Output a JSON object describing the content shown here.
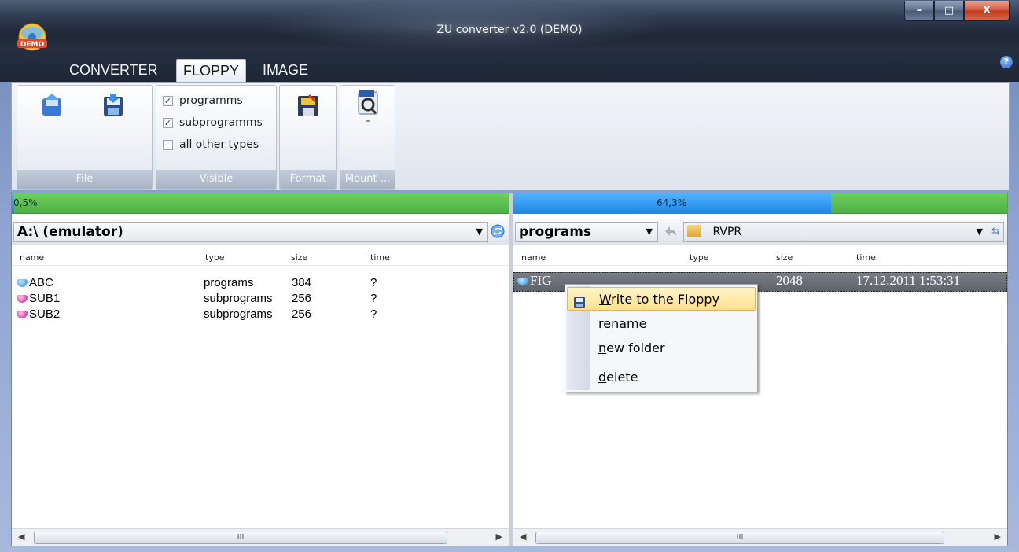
{
  "window": {
    "title": "ZU converter v2.0 (DEMO)",
    "app_icon_badge": "DEMO",
    "controls": {
      "minimize": "–",
      "maximize": "□",
      "close": "X"
    }
  },
  "ribbon": {
    "tabs": [
      "CONVERTER",
      "FLOPPY",
      "IMAGE"
    ],
    "active_tab": "FLOPPY",
    "help": "?",
    "groups": {
      "file": {
        "label": "File"
      },
      "visible": {
        "label": "Visible",
        "options": [
          {
            "label": "programms",
            "checked": true
          },
          {
            "label": "subprogramms",
            "checked": true
          },
          {
            "label": "all other types",
            "checked": false
          }
        ],
        "check_mark": "✓"
      },
      "format": {
        "label": "Format"
      },
      "mount": {
        "label": "Mount ..."
      }
    }
  },
  "left_pane": {
    "usage_text": "0,5%",
    "usage_percent": 0.5,
    "drive": "A:\\ (emulator)",
    "columns": [
      "name",
      "type",
      "size",
      "time"
    ],
    "rows": [
      {
        "name": "ABC",
        "type": "programs",
        "size": "384",
        "time": "?",
        "icon": "blue-gem"
      },
      {
        "name": "SUB1",
        "type": "subprograms",
        "size": "256",
        "time": "?",
        "icon": "pink-gem"
      },
      {
        "name": "SUB2",
        "type": "subprograms",
        "size": "256",
        "time": "?",
        "icon": "pink-gem"
      }
    ],
    "scroll_grip": "III"
  },
  "right_pane": {
    "usage_text": "64,3%",
    "usage_percent": 64.3,
    "filter": "programs",
    "folder": "RVPR",
    "columns": [
      "name",
      "type",
      "size",
      "time"
    ],
    "rows": [
      {
        "name": "FIG",
        "type": "",
        "size": "2048",
        "time": "17.12.2011 1:53:31",
        "icon": "blue-gem",
        "selected": true
      }
    ],
    "scroll_grip": "III"
  },
  "context_menu": {
    "items": [
      {
        "label": "Write to the Floppy",
        "accel": "W",
        "rest": "rite to the Floppy"
      },
      {
        "label": "rename",
        "accel": "r",
        "rest": "ename"
      },
      {
        "label": "new folder",
        "accel": "n",
        "rest": "ew folder"
      },
      {
        "label": "delete",
        "accel": "d",
        "rest": "elete"
      }
    ]
  },
  "colors": {
    "progress_used": "#1e86e6",
    "progress_free": "#4bb240",
    "menu_highlight": "#ffe18d"
  }
}
